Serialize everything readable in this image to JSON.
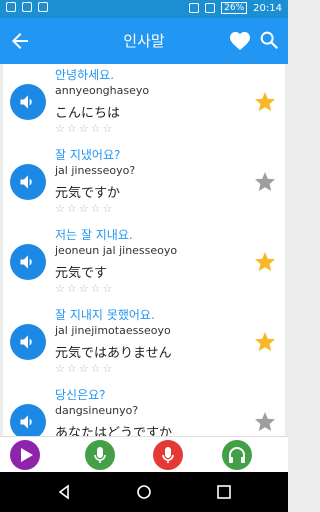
{
  "status": {
    "battery": "26%",
    "time": "20:14"
  },
  "appbar": {
    "title": "인사말"
  },
  "phrases": [
    {
      "korean": "안녕하세요.",
      "roman": "annyeonghaseyo",
      "japanese": "こんにちは",
      "rating": "☆☆☆☆☆",
      "favorite": true
    },
    {
      "korean": "잘 지냈어요?",
      "roman": "jal jinesseoyo?",
      "japanese": "元気ですか",
      "rating": "☆☆☆☆☆",
      "favorite": false
    },
    {
      "korean": "저는 잘 지내요.",
      "roman": "jeoneun jal jinesseoyo",
      "japanese": "元気です",
      "rating": "☆☆☆☆☆",
      "favorite": true
    },
    {
      "korean": "잘 지내지 못했어요.",
      "roman": "jal jinejimotaesseoyo",
      "japanese": "元気ではありません",
      "rating": "☆☆☆☆☆",
      "favorite": true
    },
    {
      "korean": "당신은요?",
      "roman": "dangsineunyo?",
      "japanese": "あなたはどうですか",
      "rating": "☆☆☆☆☆",
      "favorite": false
    }
  ],
  "colors": {
    "accent": "#2196f3",
    "star_on": "#f9b826",
    "star_off": "#9e9e9e",
    "play": "#8e24aa",
    "mic": "#43a047",
    "record": "#e53935",
    "headphones": "#43a047"
  }
}
